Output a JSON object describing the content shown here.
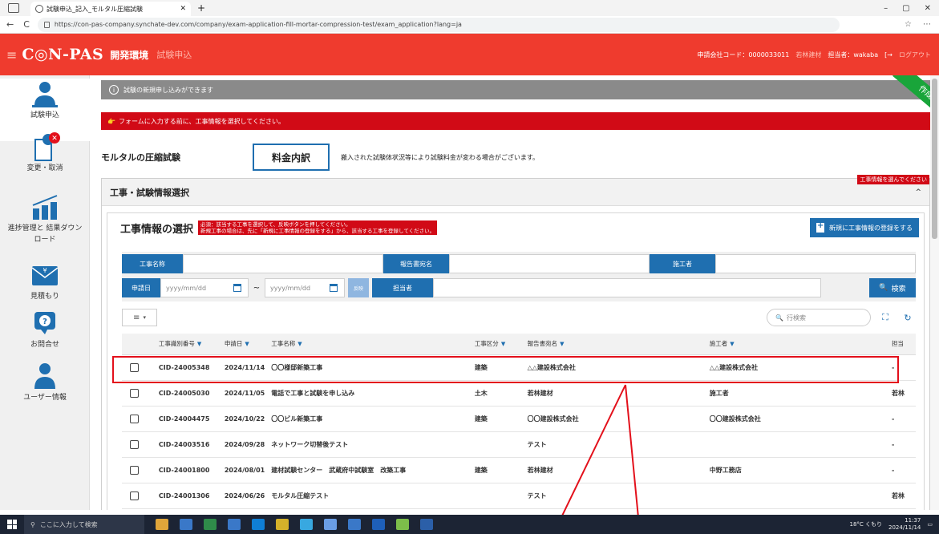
{
  "browser": {
    "tab_title": "試験申込_記入_モルタル圧縮試験",
    "new_tab": "+",
    "url": "https://con-pas-company.synchate-dev.com/company/exam-application-fill-mortar-compression-test/exam_application?lang=ja",
    "window_controls": [
      "–",
      "▢",
      "✕"
    ],
    "nav": [
      "←",
      "C"
    ]
  },
  "header": {
    "menu_icon": "≡",
    "logo": "C◎N-PAS",
    "env": "開発環境",
    "page": "試験申込",
    "company_code": "申請会社コード：0000033011",
    "company_name": "若林建材",
    "user": "担当者：wakaba",
    "logout": "ログアウト"
  },
  "sidebar": {
    "items": [
      {
        "label": "試験申込",
        "icon": "person-icon"
      },
      {
        "label": "変更・取消",
        "icon": "edit-icon"
      },
      {
        "label": "進捗管理と 結果ダウンロード",
        "icon": "bar-chart-icon"
      },
      {
        "label": "見積もり",
        "icon": "envelope-icon"
      },
      {
        "label": "お問合せ",
        "icon": "question-icon"
      },
      {
        "label": "ユーザー情報",
        "icon": "user-icon"
      }
    ]
  },
  "main": {
    "notice_grey": "試験の新規申し込みができます",
    "notice_icon": "i",
    "ribbon": "作成",
    "notice_red": "フォームに入力する前に、工事情報を選択してください。",
    "title": "モルタルの圧縮試験",
    "fee_button": "料金内訳",
    "fee_note": "搬入された試験体状況等により試験料金が変わる場合がございます。",
    "panel": {
      "title": "工事・試験情報選択",
      "warn": "工事情報を選んでください",
      "caret": "^",
      "sub_title": "工事情報の選択",
      "req_line1": "必須：該当する工事を選択して、反映ボタンを押してください。",
      "req_line2": "新規工事の場合は、先に「新規に工事情報の登録をする」から、該当する工事を登録してください。",
      "new_button": "新規に工事情報の登録をする"
    },
    "search": {
      "kouji_name_label": "工事名称",
      "report_label": "報告書宛名",
      "contractor_label": "施工者",
      "date_label": "申請日",
      "date_from_placeholder": "yyyy/mm/dd",
      "tilde": "~",
      "date_to_placeholder": "yyyy/mm/dd",
      "apply_label": "反映",
      "person_label": "担当者",
      "search_button": "検索"
    },
    "toolbar": {
      "menu_icon": "≡",
      "row_search_placeholder": "行検索"
    },
    "table": {
      "headers": [
        "工事識別番号",
        "申請日",
        "工事名称",
        "工事区分",
        "報告書宛名",
        "施工者",
        "担当"
      ],
      "rows": [
        [
          "CID-24005348",
          "2024/11/14",
          "〇〇様邸新築工事",
          "建築",
          "△△建設株式会社",
          "△△建設株式会社",
          "-"
        ],
        [
          "CID-24005030",
          "2024/11/05",
          "電話で工事と試験を申し込み",
          "土木",
          "若林建材",
          "施工者",
          "若林"
        ],
        [
          "CID-24004475",
          "2024/10/22",
          "〇〇ビル新築工事",
          "建築",
          "〇〇建設株式会社",
          "〇〇建設株式会社",
          "-"
        ],
        [
          "CID-24003516",
          "2024/09/28",
          "ネットワーク切替後テスト",
          "",
          "テスト",
          "",
          "-"
        ],
        [
          "CID-24001800",
          "2024/08/01",
          "建材試験センター　武蔵府中試験室　改築工事",
          "建築",
          "若林建材",
          "中野工務店",
          "-"
        ],
        [
          "CID-24001306",
          "2024/06/26",
          "モルタル圧縮テスト",
          "",
          "テスト",
          "",
          "若林"
        ]
      ]
    }
  },
  "taskbar": {
    "search_placeholder": "ここに入力して検索",
    "weather": "18°C くもり",
    "time": "11:37",
    "date": "2024/11/14"
  },
  "colors": {
    "header_red": "#ef3b2e",
    "notice_red": "#d10a16",
    "primary_blue": "#1f6fb0",
    "ribbon_green": "#19a53a"
  }
}
